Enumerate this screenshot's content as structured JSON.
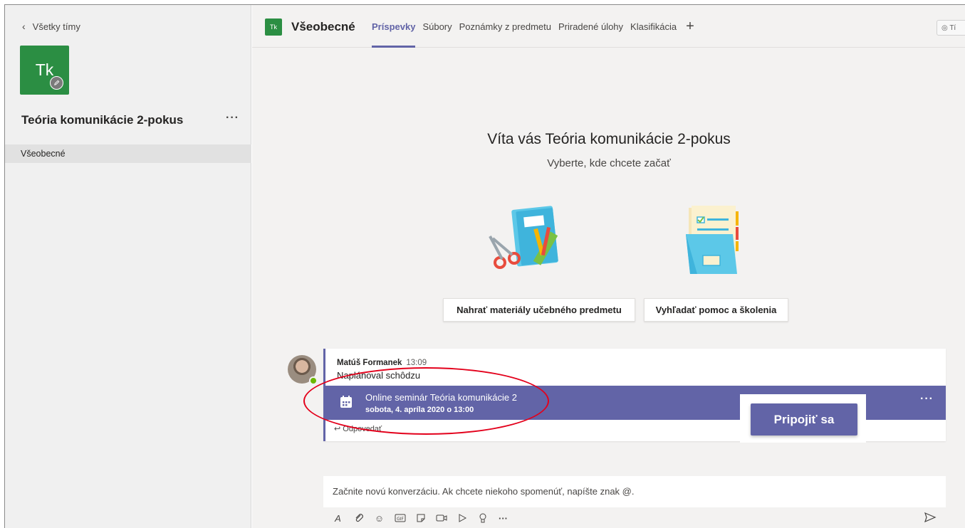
{
  "sidebar": {
    "back_label": "Všetky tímy",
    "team_initials": "Tk",
    "team_name": "Teória komunikácie 2-pokus",
    "more": "···",
    "channels": [
      {
        "label": "Všeobecné"
      }
    ]
  },
  "header": {
    "channel_initials": "Tk",
    "channel_name": "Všeobecné",
    "tabs": [
      {
        "label": "Príspevky"
      },
      {
        "label": "Súbory"
      },
      {
        "label": "Poznámky z predmetu"
      },
      {
        "label": "Priradené úlohy"
      },
      {
        "label": "Klasifikácia"
      }
    ],
    "add_tab": "+",
    "team_chip": "◎ Tí"
  },
  "welcome": {
    "title": "Víta vás Teória komunikácie 2-pokus",
    "subtitle": "Vyberte, kde chcete začať",
    "button_upload": "Nahrať materiály učebného predmetu",
    "button_help": "Vyhľadať pomoc a školenia"
  },
  "message": {
    "author": "Matúš Formanek",
    "time": "13:09",
    "text": "Naplánoval schôdzu",
    "meeting_title": "Online seminár Teória komunikácie 2",
    "meeting_date": "sobota, 4. apríla 2020 o 13:00",
    "more": "···",
    "reply": "Odpovedať",
    "join": "Pripojiť sa"
  },
  "compose": {
    "placeholder": "Začnite novú konverzáciu. Ak chcete niekoho spomenúť, napíšte znak @.",
    "more": "···"
  },
  "colors": {
    "accent": "#6264a7",
    "team": "#2b8e43",
    "highlight": "#e3001b"
  }
}
